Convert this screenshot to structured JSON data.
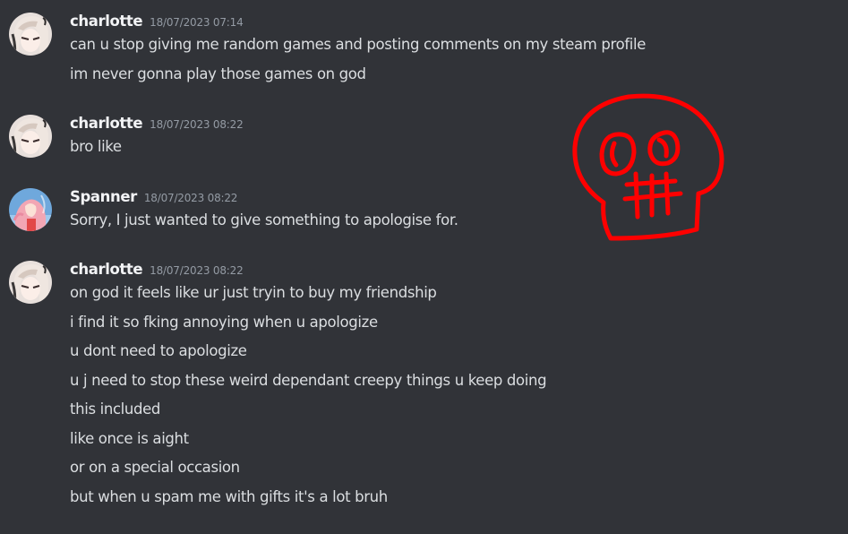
{
  "messages": [
    {
      "author": "charlotte",
      "timestamp": "18/07/2023 07:14",
      "lines": [
        "can u stop giving me random games and posting comments on my steam profile",
        "im never gonna play those games on god"
      ]
    },
    {
      "author": "charlotte",
      "timestamp": "18/07/2023 08:22",
      "lines": [
        "bro like"
      ]
    },
    {
      "author": "Spanner",
      "timestamp": "18/07/2023 08:22",
      "lines": [
        "Sorry, I just wanted to give something to apologise for."
      ]
    },
    {
      "author": "charlotte",
      "timestamp": "18/07/2023 08:22",
      "lines": [
        "on god it feels like ur just tryin to buy my friendship",
        "i find it so fking annoying when u apologize",
        "u dont need to apologize",
        "u j need to stop these weird dependant creepy things u keep doing",
        "this included",
        "like once is aight",
        "or on a special occasion",
        "but when u spam me with gifts it's a lot bruh"
      ]
    }
  ],
  "colors": {
    "background": "#313338",
    "username": "#f2f3f5",
    "timestamp": "#949ba4",
    "text": "#dbdee1",
    "doodle": "#ff0000"
  },
  "icons": {
    "charlotte_avatar": "anime-girl-avatar",
    "spanner_avatar": "pink-hair-avatar",
    "doodle": "skull-doodle"
  }
}
